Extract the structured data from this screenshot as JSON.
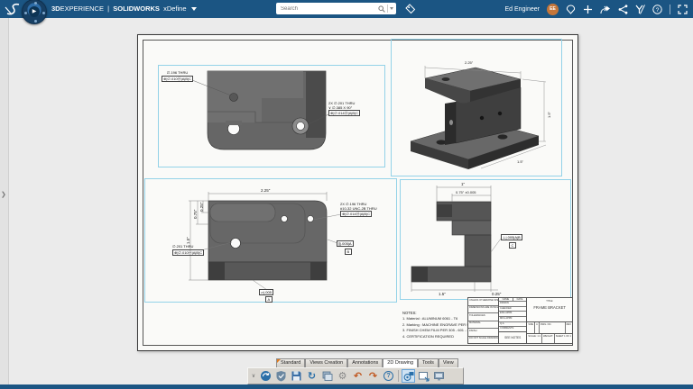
{
  "topbar": {
    "brand": {
      "p1": "3D",
      "p2": "EXPERIENCE",
      "sep": "|",
      "p3": "SOLIDWORKS",
      "app": "xDefine"
    },
    "search": {
      "placeholder": "Search"
    },
    "user": {
      "name": "Ed Engineer",
      "initials": "EE"
    },
    "accent_color": "#1b5583"
  },
  "glyphs": {
    "play": "▶",
    "panel_chevron": "❯",
    "menu_chevron": "∨",
    "gear": "⚙",
    "undo": "↶",
    "redo": "↷",
    "refresh": "↻",
    "help": "?"
  },
  "drawing": {
    "views": {
      "top": {
        "callout_hole": {
          "line1": "∅.196 THRU",
          "fcf": "⊕|∅.010Ⓜ|A|B|C"
        },
        "callout_cbore": {
          "line1": "2X ∅.201 THRU",
          "line2": "∨ ∅.385 X 90°",
          "fcf": "⊕|∅.014Ⓜ|A|B|C"
        }
      },
      "front": {
        "dim_width": "2.25\"",
        "dim_height": "1.5\"",
        "dim_h1": "0.25\"",
        "dim_h2": "0.75\"",
        "callout_tap": {
          "line1": "2X ∅.196 THRU",
          "line2": "#10-32 UNC-2B THRU",
          "fcf": "⊕|∅.014Ⓜ|A|B|C"
        },
        "callout_hole": {
          "line1": "∅.201 THRU",
          "fcf": "⊕|∅.010Ⓜ|A|B|C"
        },
        "fcf_side": "∥|.005|A",
        "datum_side": "B",
        "fcf_bottom": "▱|.005",
        "datum_bottom": "A"
      },
      "side": {
        "dim_width": "1\"",
        "dim_inner": "0.75\" ±0.005",
        "fcf": "⊥|.005|A|B",
        "datum": "C",
        "dim_bottom1": "1.5\"",
        "dim_bottom2": "0.25\""
      },
      "iso": {
        "dim_top": "2.25\"",
        "dim_right": "1.5\"",
        "dim_depth": "1.5\""
      }
    },
    "notes": {
      "title": "NOTES:",
      "items": [
        "1. Material : ALUMINUM 6061 - T6",
        "2. Marking : MACHINE ENGRAVE PER SPEC",
        "3. FINISH CHEM FILM PER 305 - 601 - x8",
        "4. CERTIFICATION REQUIRED"
      ]
    },
    "titleblock": {
      "title_label": "TITLE:",
      "title": "FRAME BRACKET",
      "material": "SEE NOTES",
      "name_col": "NAME",
      "date_col": "DATE",
      "rows": [
        "DRAWN",
        "CHECKED",
        "ENG APPR.",
        "MFG APPR.",
        "Q.A.",
        "COMMENTS:"
      ],
      "tol_lines": [
        "UNLESS OTHERWISE SPECIFIED:",
        "DIMENSIONS ARE IN INCHES",
        "TOLERANCES:",
        "MATERIAL",
        "FINISH",
        "DO NOT SCALE DRAWING"
      ],
      "size_label": "SIZE",
      "size": "A",
      "dwg_label": "DWG. NO.",
      "rev_label": "REV",
      "scale": "SCALE: 1:1",
      "weight": "WEIGHT:",
      "sheet": "SHEET 1 OF 1"
    }
  },
  "toolbar": {
    "tabs": [
      {
        "label": "Standard"
      },
      {
        "label": "Views Creation"
      },
      {
        "label": "Annotations"
      },
      {
        "label": "2D Drawing",
        "active": true
      },
      {
        "label": "Tools"
      },
      {
        "label": "View"
      }
    ]
  }
}
